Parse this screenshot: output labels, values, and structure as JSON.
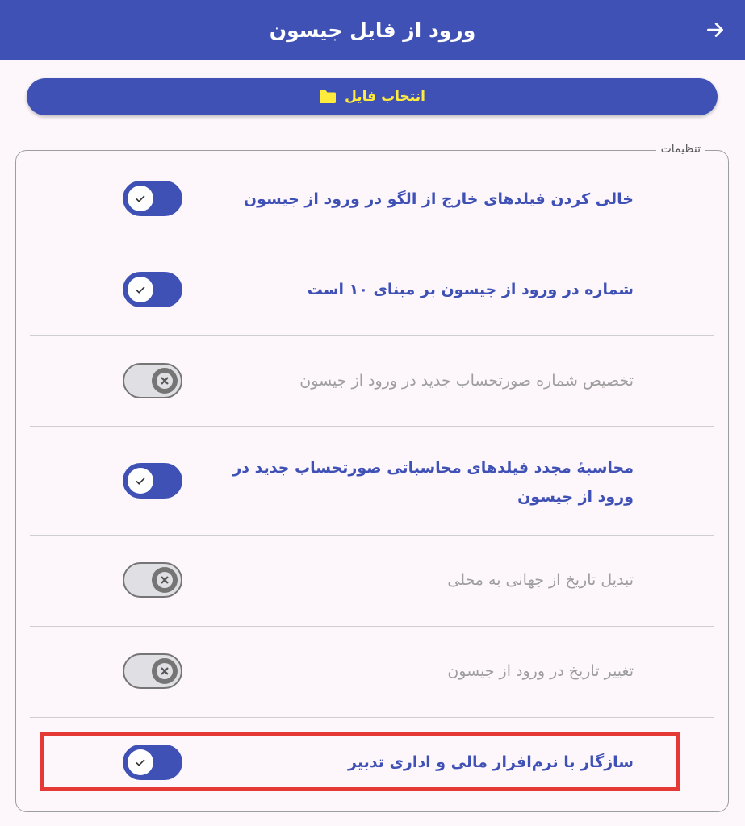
{
  "header": {
    "title": "ورود از فایل جیسون",
    "back_icon": "arrow-right-icon",
    "background": "#3f51b5"
  },
  "pick_button": {
    "label": "انتخاب فایل",
    "icon": "folder-icon",
    "label_color": "#ffeb3b"
  },
  "settings": {
    "legend": "تنظیمات",
    "items": [
      {
        "label": "خالی کردن فیلدهای خارج از الگو در ورود از جیسون",
        "enabled": true,
        "checked": true
      },
      {
        "label": "شماره در ورود از جیسون بر مبنای ۱۰ است",
        "enabled": true,
        "checked": true
      },
      {
        "label": "تخصیص شماره صورتحساب جدید در ورود از جیسون",
        "enabled": false,
        "checked": false
      },
      {
        "label": "محاسبهٔ مجدد فیلدهای محاسباتی صورتحساب جدید در ورود از جیسون",
        "enabled": true,
        "checked": true
      },
      {
        "label": "تبدیل تاریخ از جهانی به محلی",
        "enabled": false,
        "checked": false
      },
      {
        "label": "تغییر تاریخ در ورود از جیسون",
        "enabled": false,
        "checked": false
      },
      {
        "label": "سازگار با نرم‌افزار مالی و اداری تدبیر",
        "enabled": true,
        "checked": true
      }
    ]
  },
  "colors": {
    "accent": "#3f51b5",
    "disabled_text": "#9e9e9e",
    "highlight_border": "#e53935"
  }
}
